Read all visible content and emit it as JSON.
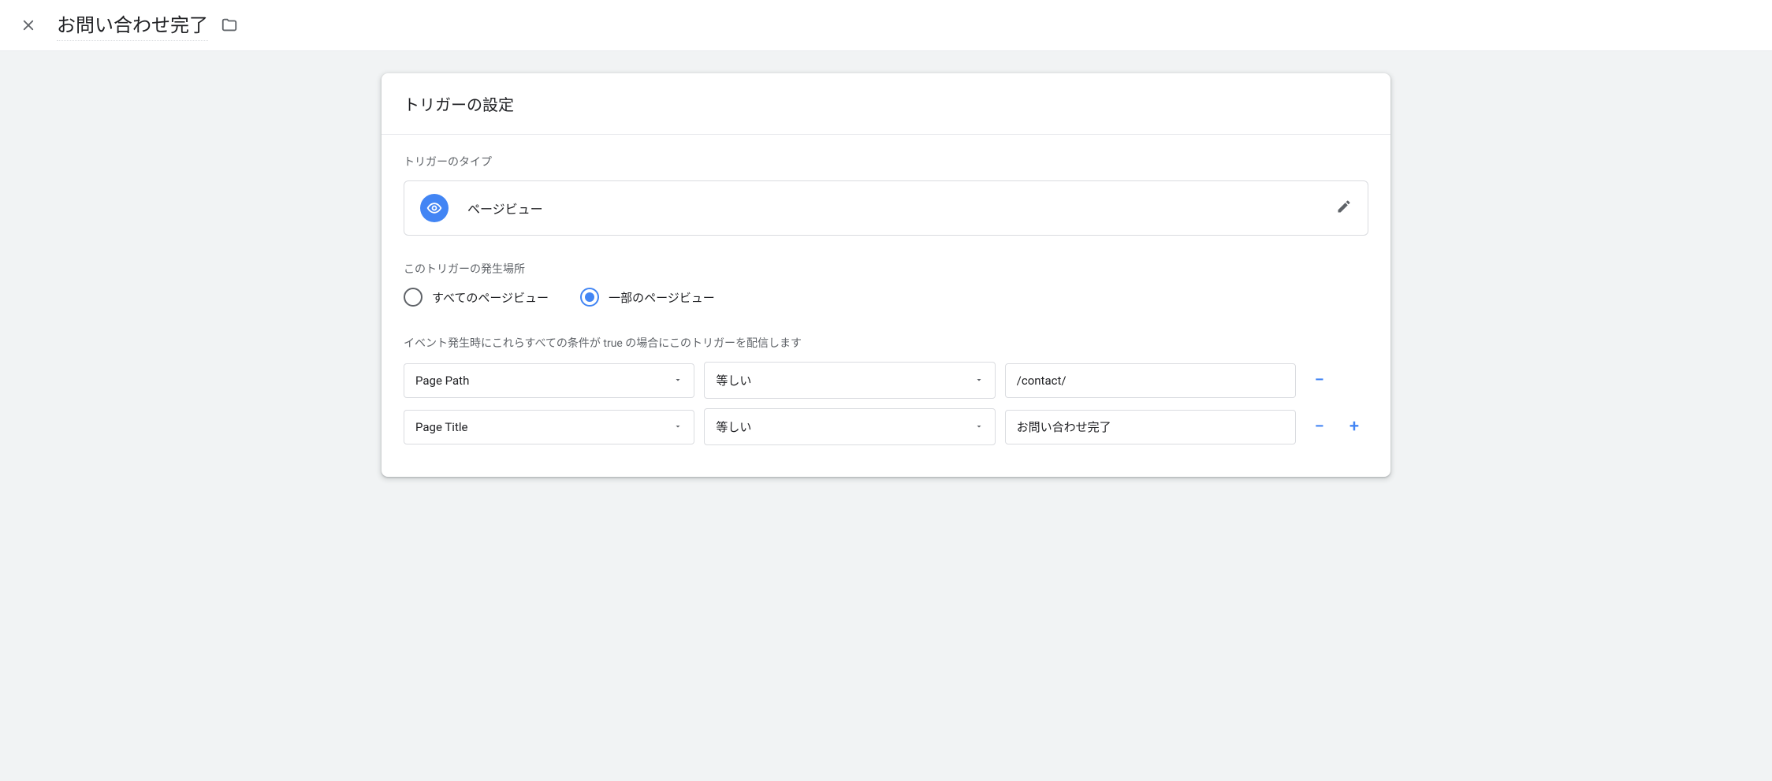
{
  "header": {
    "title": "お問い合わせ完了"
  },
  "card": {
    "title": "トリガーの設定",
    "type_section_label": "トリガーのタイプ",
    "trigger_type_name": "ページビュー",
    "fire_section_label": "このトリガーの発生場所",
    "radio_all_label": "すべてのページビュー",
    "radio_some_label": "一部のページビュー",
    "condition_help": "イベント発生時にこれらすべての条件が true の場合にこのトリガーを配信します",
    "conditions": [
      {
        "variable": "Page Path",
        "operator": "等しい",
        "value": "/contact/"
      },
      {
        "variable": "Page Title",
        "operator": "等しい",
        "value": "お問い合わせ完了"
      }
    ]
  }
}
